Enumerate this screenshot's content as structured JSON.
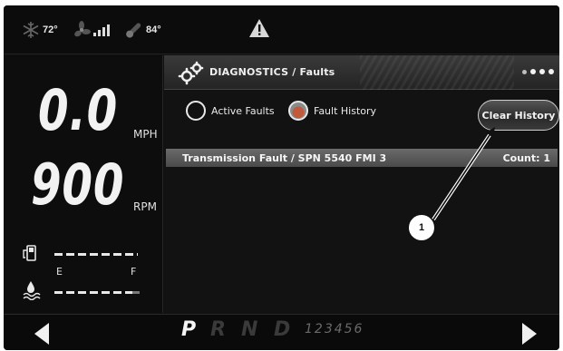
{
  "statusbar": {
    "snowflake_icon": "snowflake-icon",
    "fan_icon": "fan-icon",
    "thermometer_icon": "thermometer-icon",
    "ac_temp": "72°",
    "outside_temp": "84°",
    "warning_icon": "warning-triangle-icon"
  },
  "gauges": {
    "speed": "0.0",
    "speed_unit": "MPH",
    "rpm": "900",
    "rpm_unit": "RPM",
    "fuel_empty": "E",
    "fuel_full": "F"
  },
  "diagnostics": {
    "title": "DIAGNOSTICS / Faults",
    "radio_active": "Active Faults",
    "radio_history": "Fault History",
    "selected": "history",
    "clear_button": "Clear History",
    "page_dots": 4
  },
  "faults": [
    {
      "description": "Transmission Fault / SPN 5540 FMI 3",
      "count": "Count: 1"
    }
  ],
  "gearbar": {
    "gears": [
      "P",
      "R",
      "N",
      "D"
    ],
    "active_gear": "P",
    "numbers": "123456"
  },
  "callout": {
    "label": "1"
  },
  "colors": {
    "background": "#101010",
    "text": "#f2f2f2",
    "accent_radio": "#c05a3a"
  }
}
